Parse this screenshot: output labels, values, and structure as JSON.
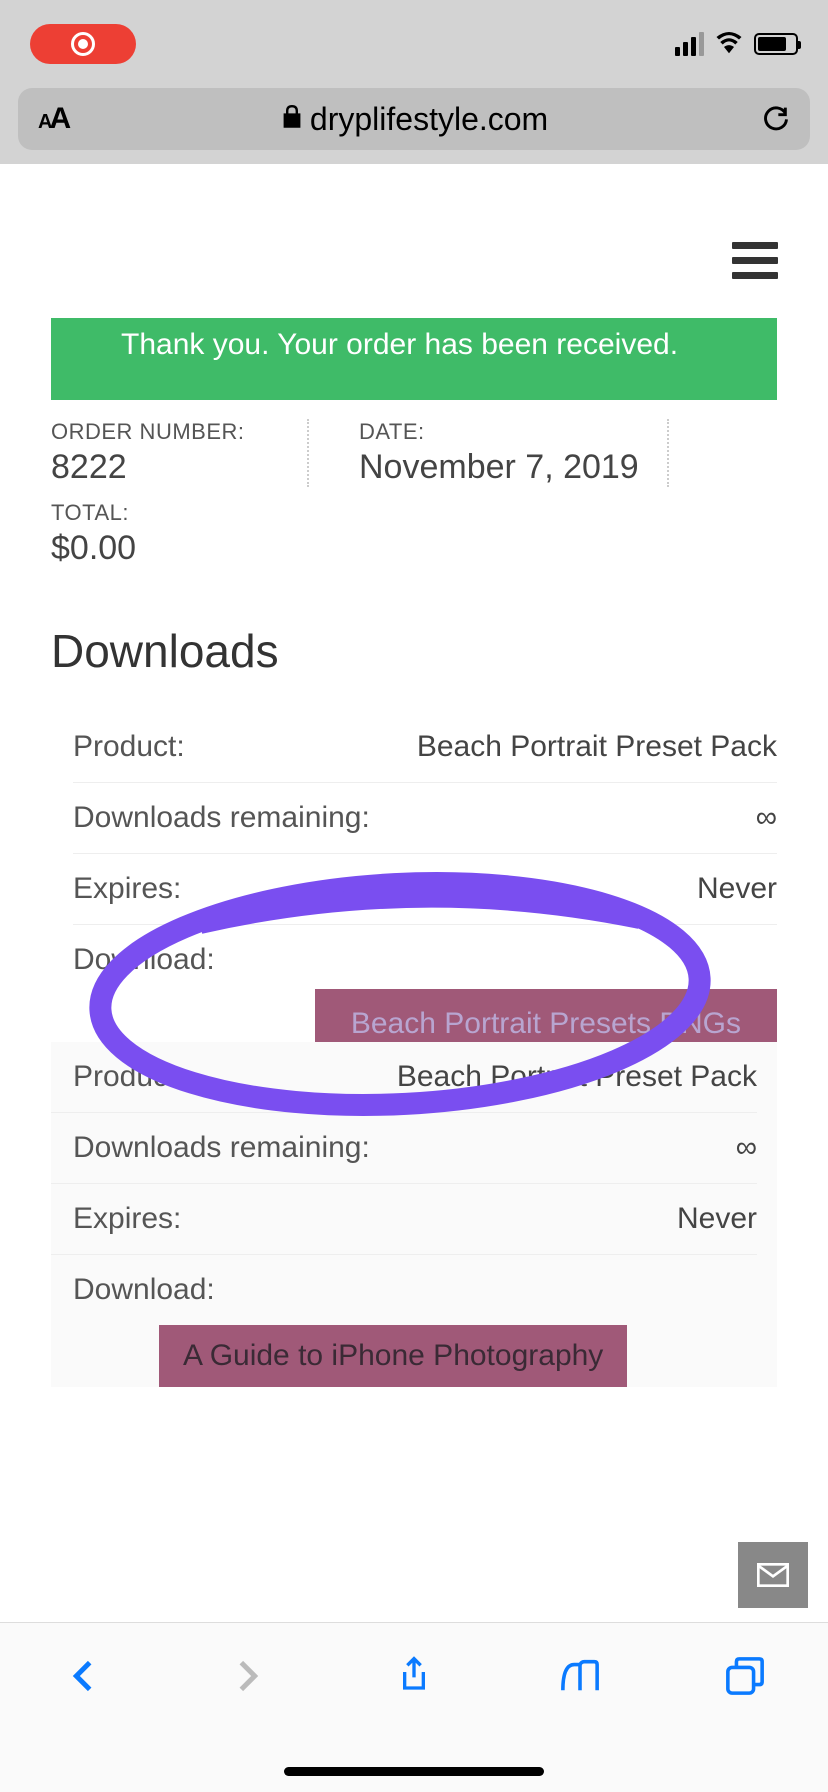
{
  "url": "dryplifestyle.com",
  "success_message": "Thank you. Your order has been received.",
  "order": {
    "order_number_label": "ORDER NUMBER:",
    "order_number": "8222",
    "date_label": "DATE:",
    "date": "November 7, 2019",
    "total_label": "TOTAL:",
    "total": "$0.00"
  },
  "downloads_heading": "Downloads",
  "labels": {
    "product": "Product:",
    "downloads_remaining": "Downloads remaining:",
    "expires": "Expires:",
    "download": "Download:"
  },
  "items": [
    {
      "product": "Beach Portrait Preset Pack",
      "remaining": "∞",
      "expires": "Never",
      "button_label": "Beach Portrait Presets DNGs"
    },
    {
      "product": "Beach Portrait Preset Pack",
      "remaining": "∞",
      "expires": "Never",
      "button_label": "A Guide to iPhone Photography"
    }
  ]
}
